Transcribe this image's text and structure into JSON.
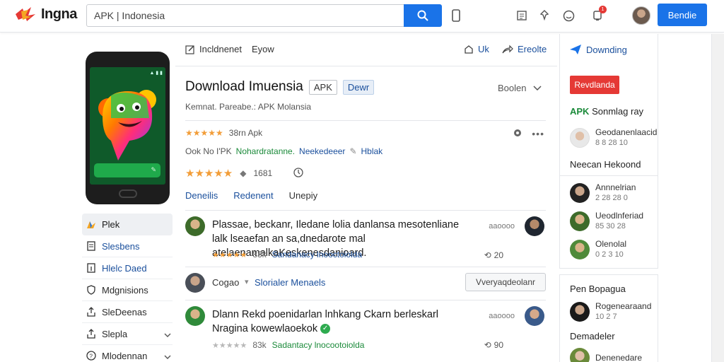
{
  "header": {
    "logo_text": "Ingna",
    "search_value": "APK | Indonesia",
    "primary_button": "Bendie",
    "notification_count": "1"
  },
  "left": {
    "menu": [
      {
        "label": "Plek",
        "icon": "logo-icon"
      },
      {
        "label": "Slesbens",
        "icon": "document-icon"
      },
      {
        "label": "Hlelc Daed",
        "icon": "info-icon"
      },
      {
        "label": "Mdgnisions",
        "icon": "shield-icon"
      },
      {
        "label": "SleDeenas",
        "icon": "share-icon"
      },
      {
        "label": "Slepla",
        "icon": "share-icon"
      },
      {
        "label": "Mlodennan",
        "icon": "help-icon"
      }
    ]
  },
  "main": {
    "top_left_1": "Incldnenet",
    "top_left_2": "Eyow",
    "top_right_1": "Uk",
    "top_right_2": "Ereolte",
    "title": "Download Imuensia",
    "chip_1": "APK",
    "chip_2": "Dewr",
    "sort_label": "Boolen",
    "subtitle": "Kemnat. Pareabe.: APK Molansia",
    "rating_text": "38rn Apk",
    "meta_prefix": "Ook No I'PK",
    "meta_green": "Nohardratanne.",
    "meta_blue": "Neekedeeer",
    "meta_end": "Hblak",
    "score": "1681",
    "tabs": [
      "Deneilis",
      "Redenent",
      "Unepiy"
    ],
    "comments": [
      {
        "text": "Plassae, beckanr, Iledane lolia danlansa mesotenliane lalk lseaefan an sa,dnedarote mal atelaenamalkaKeskenesdanioard.",
        "side": "aaoooo",
        "count": "83k",
        "link": "Sandanacy lnooctoiolda",
        "replies": "20"
      },
      {
        "text": "Dlann Rekd poenidarlan lnhkang Ckarn berleskarl Nragina kowewlaoekok",
        "side": "aaoooo",
        "count": "83k",
        "link": "Sadantacy lnocootoiolda",
        "replies": "90"
      }
    ],
    "reply_name": "Cogao",
    "reply_link": "Slorialer Menaels",
    "reply_button": "Vveryaqdeolanr"
  },
  "right": {
    "head": "Downding",
    "red_button": "Revdlanda",
    "apk_bold": "APK",
    "apk_rest": "Sonmlag ray",
    "users_1": [
      {
        "name": "Geodanenlaacid",
        "sub": "8 8 28 10"
      }
    ],
    "label_1": "Neecan Hekoond",
    "users_2": [
      {
        "name": "Annnelrian",
        "sub": "2 28 28 0"
      },
      {
        "name": "Ueodlnferiad",
        "sub": "85 30 28"
      },
      {
        "name": "Olenolal",
        "sub": "0 2 3 10"
      }
    ],
    "label_2": "Pen Bopagua",
    "users_3": [
      {
        "name": "Rogenearaand",
        "sub": "10 2 7"
      }
    ],
    "label_3": "Demadeler",
    "users_4": [
      {
        "name": "Denenedare"
      }
    ]
  },
  "colors": {
    "accent": "#1a73e8",
    "red": "#e53935",
    "green": "#1b8a3a",
    "link": "#1a4f9c",
    "star": "#f29d38"
  }
}
